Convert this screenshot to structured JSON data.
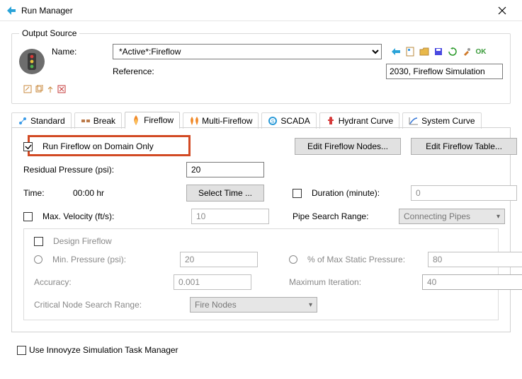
{
  "window": {
    "title": "Run Manager"
  },
  "outputSource": {
    "legend": "Output Source",
    "nameLabel": "Name:",
    "nameValue": "*Active*:Fireflow",
    "refLabel": "Reference:",
    "refValue": "2030, Fireflow Simulation",
    "okText": "OK"
  },
  "tabs": {
    "standard": "Standard",
    "break": "Break",
    "fireflow": "Fireflow",
    "multiFireflow": "Multi-Fireflow",
    "scada": "SCADA",
    "hydrantCurve": "Hydrant Curve",
    "systemCurve": "System Curve"
  },
  "fireflow": {
    "runDomainOnly": "Run Fireflow on Domain Only",
    "runDomainOnlyChecked": true,
    "editFireflowNodes": "Edit Fireflow Nodes...",
    "editFireflowTable": "Edit Fireflow Table...",
    "residualPressureLabel": "Residual Pressure (psi):",
    "residualPressureValue": "20",
    "timeLabel": "Time:",
    "timeValue": "00:00 hr",
    "selectTimeBtn": "Select Time ...",
    "durationLabel": "Duration (minute):",
    "durationChecked": false,
    "durationValue": "0",
    "maxVelocityLabel": "Max. Velocity (ft/s):",
    "maxVelocityChecked": false,
    "maxVelocityValue": "10",
    "pipeSearchRangeLabel": "Pipe Search Range:",
    "pipeSearchRangeValue": "Connecting Pipes",
    "design": {
      "header": "Design Fireflow",
      "headerChecked": false,
      "minPressureLabel": "Min. Pressure (psi):",
      "minPressureValue": "20",
      "pctMaxStaticLabel": "% of Max Static Pressure:",
      "pctMaxStaticValue": "80",
      "accuracyLabel": "Accuracy:",
      "accuracyValue": "0.001",
      "maxIterLabel": "Maximum Iteration:",
      "maxIterValue": "40",
      "critNodeRangeLabel": "Critical Node Search Range:",
      "critNodeRangeValue": "Fire Nodes"
    }
  },
  "footer": {
    "useTaskManager": "Use Innovyze Simulation Task Manager",
    "useTaskManagerChecked": false
  }
}
